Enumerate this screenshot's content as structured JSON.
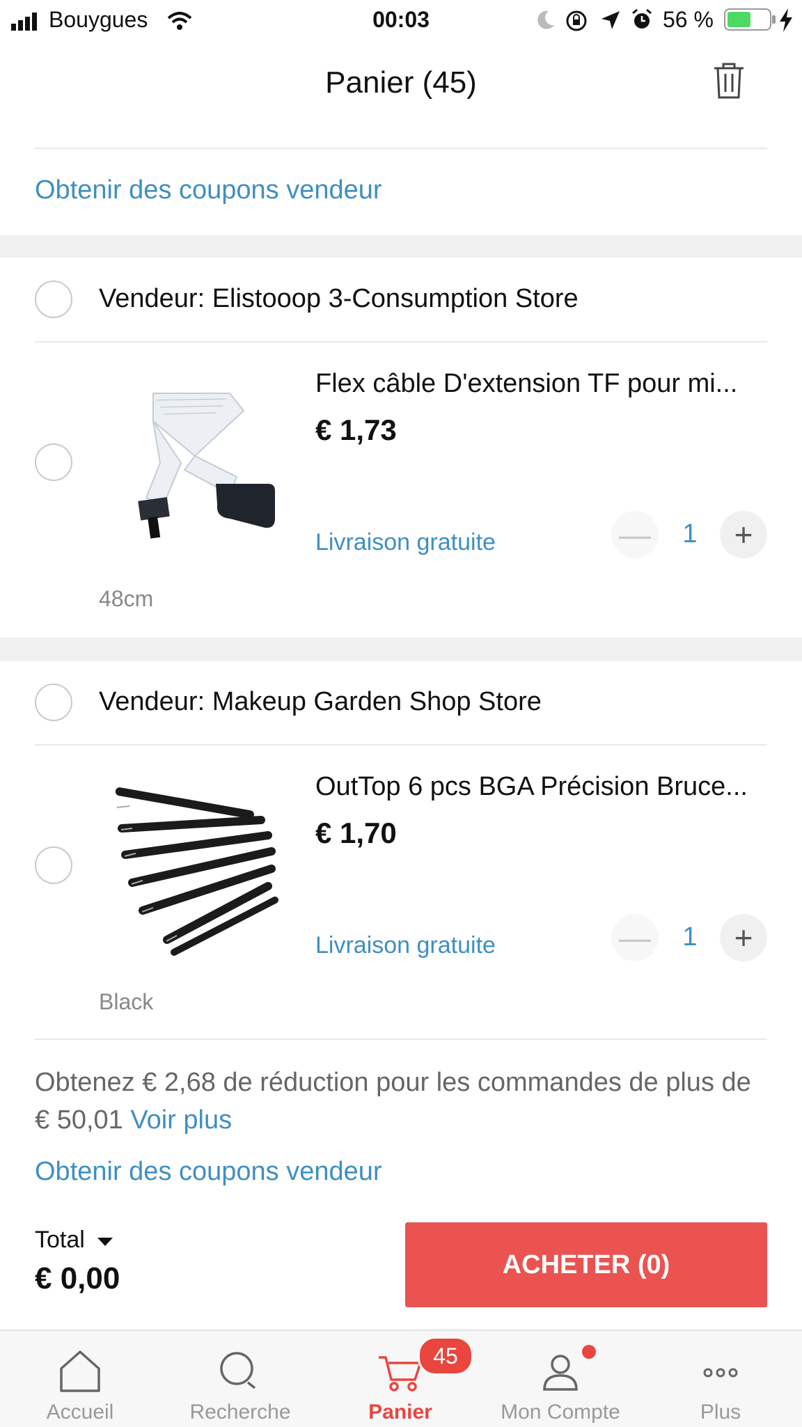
{
  "status_bar": {
    "carrier": "Bouygues",
    "time": "00:03",
    "battery_percent": "56 %"
  },
  "header": {
    "title": "Panier (45)"
  },
  "coupon_link_top": "Obtenir des coupons vendeur",
  "stores": [
    {
      "vendor": "Vendeur: Elistooop 3-Consumption Store",
      "item": {
        "name": "Flex câble D'extension TF pour mi...",
        "price": "€ 1,73",
        "shipping": "Livraison gratuite",
        "quantity": "1",
        "variant": "48cm"
      }
    },
    {
      "vendor": "Vendeur: Makeup Garden Shop Store",
      "item": {
        "name": "OutTop 6 pcs BGA Précision Bruce...",
        "price": "€ 1,70",
        "shipping": "Livraison gratuite",
        "quantity": "1",
        "variant": "Black"
      }
    }
  ],
  "discount": {
    "text": "Obtenez € 2,68 de réduction pour les commandes de plus de € 50,01",
    "more_link": "Voir plus"
  },
  "coupon_link_bottom": "Obtenir des coupons vendeur",
  "footer": {
    "total_label": "Total",
    "total_value": "€ 0,00",
    "buy_label": "ACHETER (0)"
  },
  "tabbar": {
    "items": [
      {
        "label": "Accueil",
        "icon": "home-icon"
      },
      {
        "label": "Recherche",
        "icon": "search-icon"
      },
      {
        "label": "Panier",
        "icon": "cart-icon"
      },
      {
        "label": "Mon Compte",
        "icon": "account-icon"
      },
      {
        "label": "Plus",
        "icon": "more-icon"
      }
    ],
    "cart_badge": "45"
  },
  "colors": {
    "accent_red": "#ea5350",
    "link_blue": "#3f8fc0"
  }
}
